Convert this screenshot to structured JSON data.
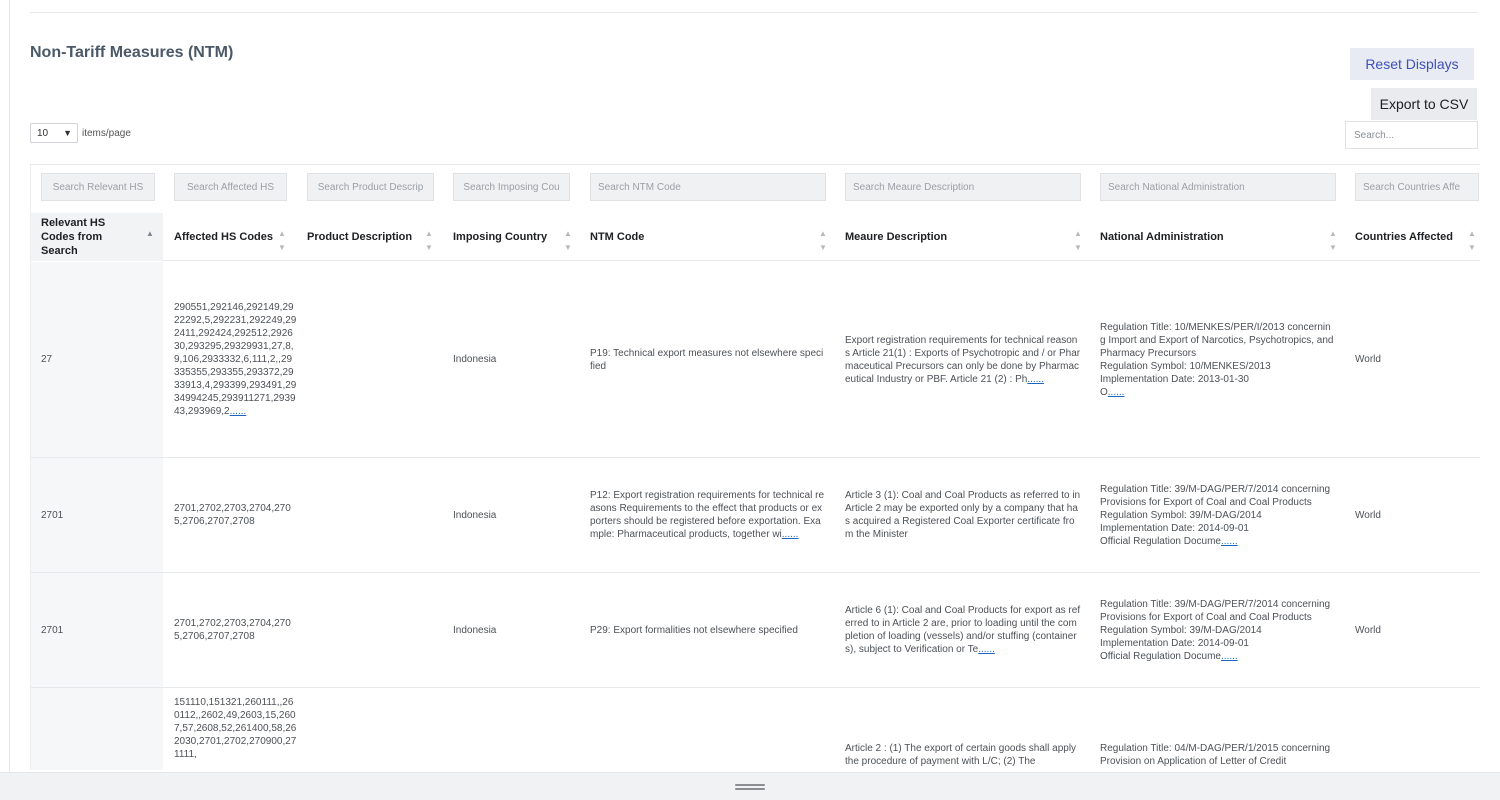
{
  "page": {
    "title": "Non-Tariff Measures (NTM)"
  },
  "toolbar": {
    "reset_label": "Reset Displays",
    "export_label": "Export to CSV"
  },
  "pager": {
    "selected": "10",
    "label": "items/page"
  },
  "search": {
    "placeholder": "Search..."
  },
  "filters": [
    "Search Relevant HS",
    "Search Affected HS",
    "Search Product Descrip",
    "Search Imposing Cou",
    "Search NTM Code",
    "Search Meaure Description",
    "Search National Administration",
    "Search Countries Affe"
  ],
  "columns": [
    "Relevant HS Codes from Search",
    "Affected HS Codes",
    "Product Description",
    "Imposing Country",
    "NTM Code",
    "Meaure Description",
    "National Administration",
    "Countries Affected"
  ],
  "more_link": "......",
  "rows": [
    {
      "relevant": "27",
      "affected": "290551,292146,292149,2922292,5,292231,292249,292411,292424,292512,292630,293295,29329931,27,8,9,106,2933332,6,111,2,,29335355,293355,293372,2933913,4,293399,293491,2934994245,293911271,293943,293969,2",
      "product": "",
      "country": "Indonesia",
      "ntm": "P19: Technical export measures not elsewhere specified",
      "ntm_more": "",
      "measure": "Export registration requirements for technical reasons Article 21(1) : Exports of Psychotropic and / or Pharmaceutical Precursors can only be done by Pharmaceutical Industry or PBF. Article 21 (2) : Ph",
      "admin": "Regulation Title: 10/MENKES/PER/I/2013 concerning Import and Export of Narcotics, Psychotropics, and Pharmacy Precursors\nRegulation Symbol: 10/MENKES/2013\nImplementation Date: 2013-01-30\nO",
      "countries": "World"
    },
    {
      "relevant": "2701",
      "affected": "2701,2702,2703,2704,2705,2706,2707,2708",
      "product": "",
      "country": "Indonesia",
      "ntm": "P12: Export registration requirements for technical reasons Requirements to the effect that products or exporters should be registered before exportation. Example: Pharmaceutical products, together wi",
      "ntm_more": "......",
      "measure": "Article 3 (1): Coal and Coal Products as referred to in Article 2 may be exported only by a company that has acquired a Registered Coal Exporter certificate from the Minister",
      "admin": "Regulation Title: 39/M-DAG/PER/7/2014 concerning Provisions for Export of Coal and Coal Products\nRegulation Symbol: 39/M-DAG/2014\nImplementation Date: 2014-09-01\nOfficial Regulation Docume",
      "countries": "World"
    },
    {
      "relevant": "2701",
      "affected": "2701,2702,2703,2704,2705,2706,2707,2708",
      "product": "",
      "country": "Indonesia",
      "ntm": "P29: Export formalities not elsewhere specified",
      "ntm_more": "",
      "measure": "Article 6 (1): Coal and Coal Products for export as referred to in Article 2 are, prior to loading until the completion of loading (vessels) and/or stuffing (containers), subject to Verification or Te",
      "admin": "Regulation Title: 39/M-DAG/PER/7/2014 concerning Provisions for Export of Coal and Coal Products\nRegulation Symbol: 39/M-DAG/2014\nImplementation Date: 2014-09-01\nOfficial Regulation Docume",
      "countries": "World"
    },
    {
      "relevant": "",
      "affected": "151110,151321,260111,,260112,,2602,49,2603,15,2607,57,2608,52,261400,58,262030,2701,2702,270900,271111,",
      "product": "",
      "country": "",
      "ntm": "",
      "ntm_more": "",
      "measure": "Article 2 : (1) The export of certain goods shall apply the procedure of payment with L/C; (2) The",
      "admin": "Regulation Title: 04/M-DAG/PER/1/2015 concerning Provision on Application of Letter of Credit",
      "countries": ""
    }
  ]
}
